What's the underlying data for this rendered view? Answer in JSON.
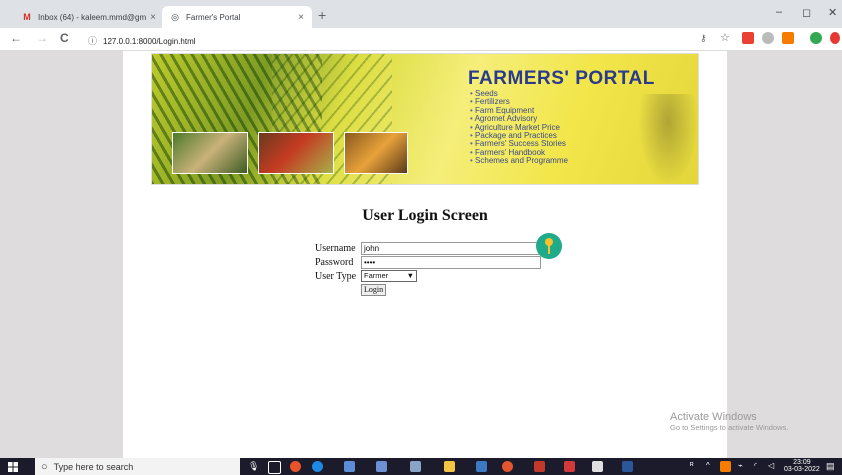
{
  "browser": {
    "tabs": [
      {
        "title": "Inbox (64) - kaleem.mmd@gmai",
        "close": "×",
        "icon": "gmail-icon"
      },
      {
        "title": "Farmer's Portal",
        "close": "×",
        "icon": "globe-icon"
      }
    ],
    "new_tab": "+",
    "window_controls": {
      "minimize": "–",
      "restore": "◻",
      "close": "✕"
    },
    "nav": {
      "back": "←",
      "forward": "→",
      "reload": "C"
    },
    "url": "127.0.0.1:8000/Login.html",
    "url_info": "ⓘ"
  },
  "banner": {
    "title": "FARMERS' PORTAL",
    "items": [
      "Seeds",
      "Fertilizers",
      "Farm Equipment",
      "Agromet Advisory",
      "Agriculture Market Price",
      "Package and Practices",
      "Farmers' Success Stories",
      "Farmers' Handbook",
      "Schemes and Programme"
    ]
  },
  "login": {
    "heading": "User Login Screen",
    "username_label": "Username",
    "username_value": "john",
    "password_label": "Password",
    "password_value": "••••",
    "usertype_label": "User Type",
    "usertype_value": "Farmer",
    "usertype_arrow": "▼",
    "button": "Login"
  },
  "watermark": {
    "line1": "Activate Windows",
    "line2": "Go to Settings to activate Windows."
  },
  "taskbar": {
    "search_placeholder": "Type here to search",
    "time": "23:09",
    "date": "03-03-2022"
  },
  "colors": {
    "banner_title": "#2a3a8c",
    "key_bg": "#1faa8a",
    "taskbar": "#1b1b2b"
  }
}
